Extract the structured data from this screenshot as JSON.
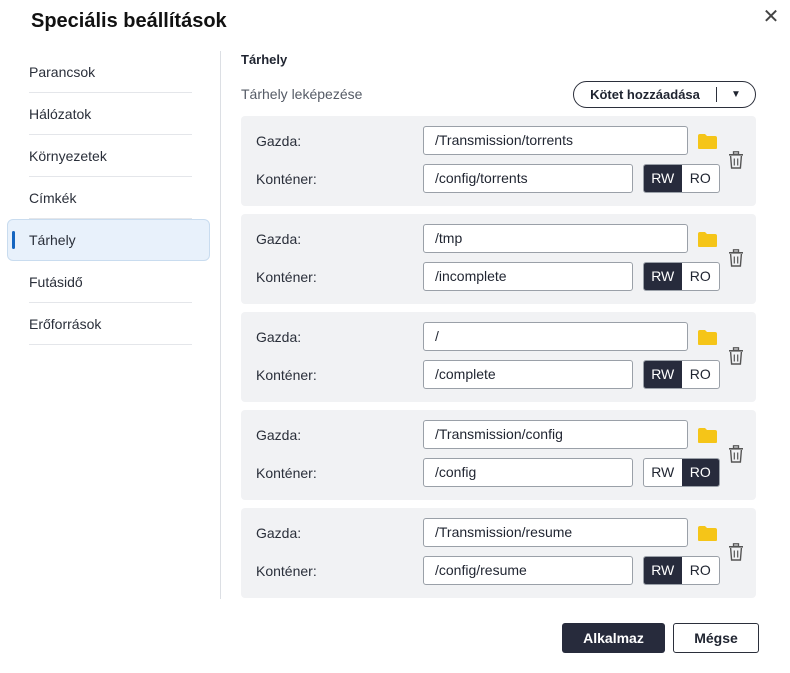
{
  "dialog": {
    "title": "Speciális beállítások",
    "close_icon": "close-icon"
  },
  "sidebar": {
    "items": [
      {
        "label": "Parancsok"
      },
      {
        "label": "Hálózatok"
      },
      {
        "label": "Környezetek"
      },
      {
        "label": "Címkék"
      },
      {
        "label": "Tárhely",
        "active": true
      },
      {
        "label": "Futásidő"
      },
      {
        "label": "Erőforrások"
      }
    ]
  },
  "storage": {
    "title": "Tárhely",
    "mapping_label": "Tárhely leképezése",
    "add_volume_label": "Kötet hozzáadása",
    "host_label": "Gazda:",
    "container_label": "Konténer:",
    "rw_label": "RW",
    "ro_label": "RO",
    "mappings": [
      {
        "host": "/Transmission/torrents",
        "container": "/config/torrents",
        "mode": "RW"
      },
      {
        "host": "/tmp",
        "container": "/incomplete",
        "mode": "RW"
      },
      {
        "host": "/",
        "container": "/complete",
        "mode": "RW"
      },
      {
        "host": "/Transmission/config",
        "container": "/config",
        "mode": "RO"
      },
      {
        "host": "/Transmission/resume",
        "container": "/config/resume",
        "mode": "RW"
      }
    ]
  },
  "footer": {
    "apply_label": "Alkalmaz",
    "cancel_label": "Mégse"
  },
  "colors": {
    "accent": "#1565c0",
    "dark": "#272b3c",
    "folder": "#f5c518"
  }
}
